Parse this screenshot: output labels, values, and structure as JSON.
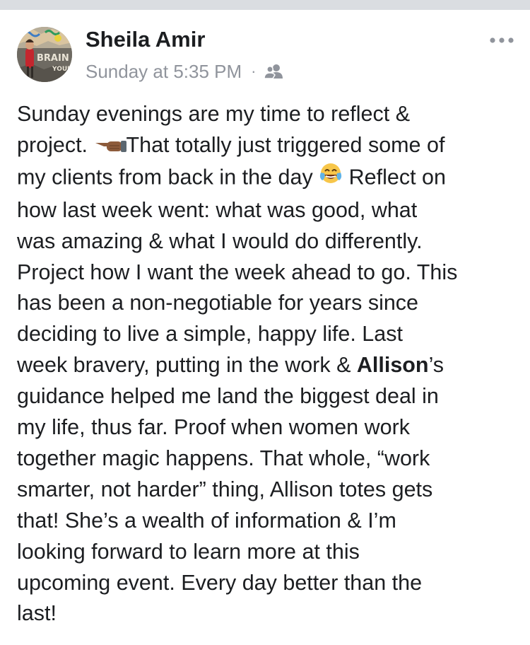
{
  "author": {
    "name": "Sheila Amir",
    "avatar_icon": "profile-photo",
    "avatar_text_top": "BRAIN",
    "avatar_text_bottom": "YOUR"
  },
  "meta": {
    "timestamp": "Sunday at 5:35 PM",
    "separator": "·",
    "audience_icon": "friends-icon"
  },
  "more_icon": "ellipsis-icon",
  "post": {
    "line1": "Sunday evenings are my time to reflect &",
    "line2a": "project. ",
    "emoji1": "backhand-index-pointing-left",
    "line2b": "That totally just triggered some of",
    "line3a": "my clients from back in the day ",
    "emoji2": "face-with-tears-of-joy",
    "line3b": " Reflect on",
    "line4": "how last week went: what was good, what",
    "line5": "was amazing & what I would do differently.",
    "line6": "Project how I want the week ahead to go. This",
    "line7": "has been a non-negotiable for years since",
    "line8": "deciding to live a simple, happy life. Last",
    "line9a": "week bravery, putting in the work & ",
    "mention": "Allison",
    "line9b": "’s",
    "line10": "guidance helped me land the biggest deal in",
    "line11": "my life, thus far. Proof when women work",
    "line12": "together magic happens. That whole, “work",
    "line13": "smarter, not harder” thing, Allison totes gets",
    "line14": "that! She’s a wealth of information & I’m",
    "line15": "looking forward to learn more at this",
    "line16": "upcoming event. Every day better than the",
    "line17": "last!"
  },
  "colors": {
    "text": "#1c1e21",
    "meta": "#90949c",
    "top_strip": "#dadde1"
  }
}
